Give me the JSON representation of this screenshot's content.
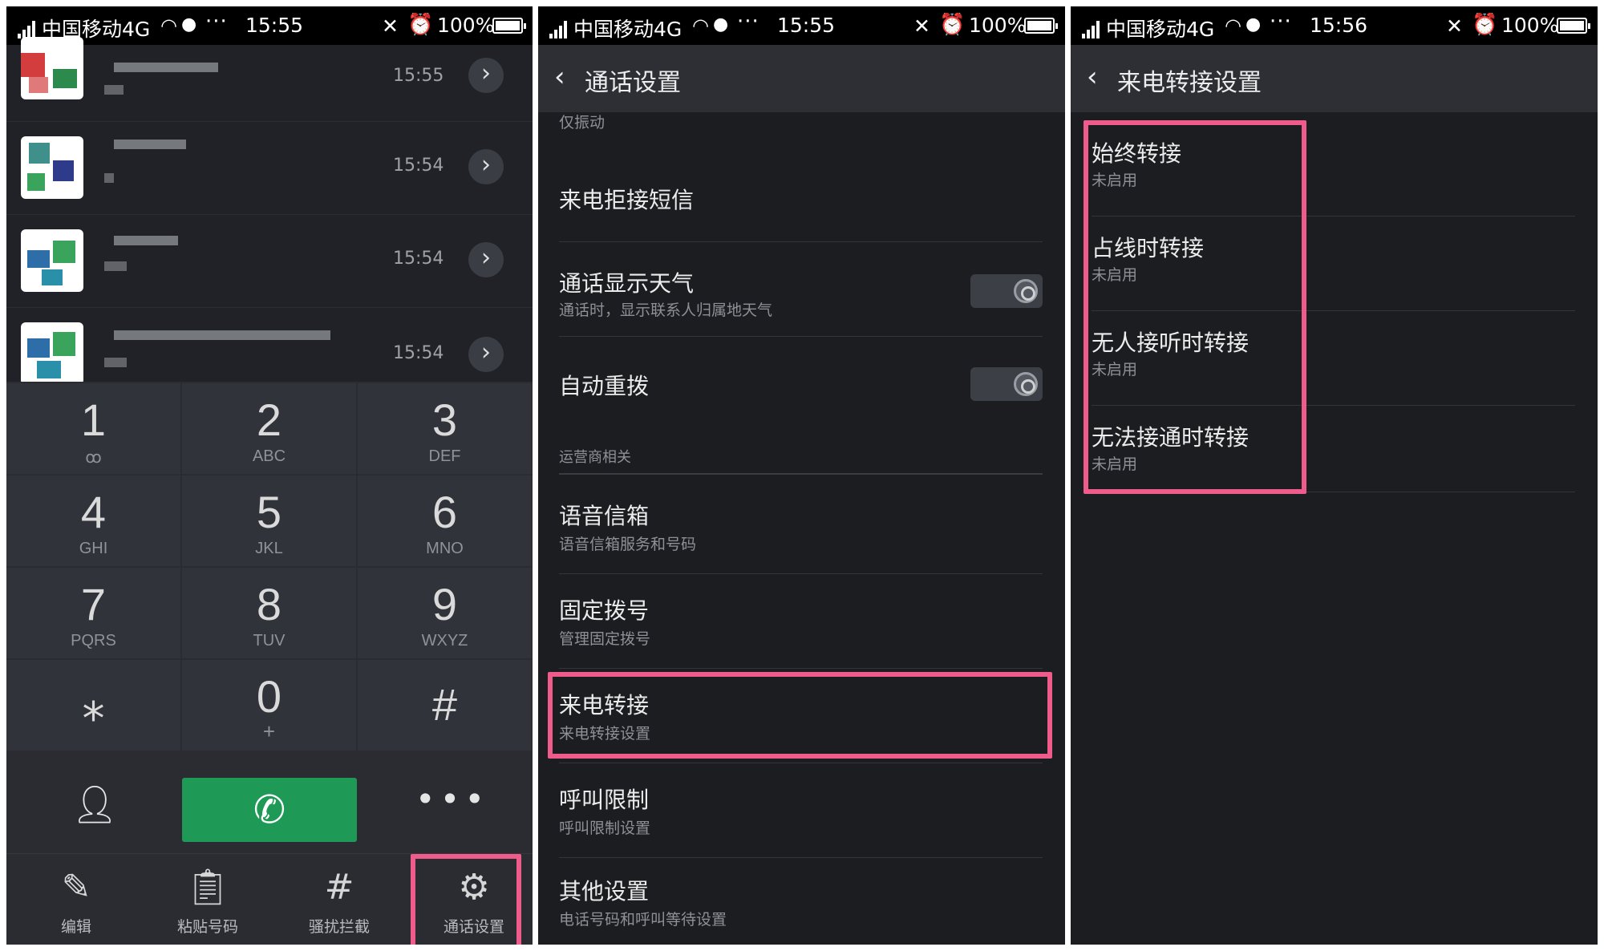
{
  "status_bars": [
    {
      "carrier": "中国移动4G",
      "time": "15:55",
      "battery": "100%",
      "battery_level": 1.0
    },
    {
      "carrier": "中国移动4G",
      "time": "15:55",
      "battery": "100%",
      "battery_level": 1.0
    },
    {
      "carrier": "中国移动4G",
      "time": "15:56",
      "battery": "100%",
      "battery_level": 1.0
    }
  ],
  "dialer": {
    "recent_calls": [
      {
        "time": "15:55"
      },
      {
        "time": "15:54"
      },
      {
        "time": "15:54"
      },
      {
        "time": "15:54"
      }
    ],
    "keys": [
      {
        "digit": "1",
        "letters": "ꝏ"
      },
      {
        "digit": "2",
        "letters": "ABC"
      },
      {
        "digit": "3",
        "letters": "DEF"
      },
      {
        "digit": "4",
        "letters": "GHI"
      },
      {
        "digit": "5",
        "letters": "JKL"
      },
      {
        "digit": "6",
        "letters": "MNO"
      },
      {
        "digit": "7",
        "letters": "PQRS"
      },
      {
        "digit": "8",
        "letters": "TUV"
      },
      {
        "digit": "9",
        "letters": "WXYZ"
      },
      {
        "digit": "⁎",
        "letters": ""
      },
      {
        "digit": "0",
        "letters": "+"
      },
      {
        "digit": "#",
        "letters": ""
      }
    ],
    "tabs": [
      {
        "label": "编辑",
        "icon": "edit-icon"
      },
      {
        "label": "粘贴号码",
        "icon": "clipboard-icon"
      },
      {
        "label": "骚扰拦截",
        "icon": "hash-icon"
      },
      {
        "label": "通话设置",
        "icon": "gear-icon"
      }
    ],
    "more_label": "•••"
  },
  "call_settings": {
    "title": "通话设置",
    "top_partial": "仅振动",
    "items": [
      {
        "main": "来电拒接短信",
        "sub": ""
      },
      {
        "main": "通话显示天气",
        "sub": "通话时，显示联系人归属地天气",
        "toggle": false
      },
      {
        "main": "自动重拨",
        "sub": "",
        "toggle": false
      }
    ],
    "section_label": "运营商相关",
    "carrier_items": [
      {
        "main": "语音信箱",
        "sub": "语音信箱服务和号码"
      },
      {
        "main": "固定拨号",
        "sub": "管理固定拨号"
      },
      {
        "main": "来电转接",
        "sub": "来电转接设置"
      },
      {
        "main": "呼叫限制",
        "sub": "呼叫限制设置"
      },
      {
        "main": "其他设置",
        "sub": "电话号码和呼叫等待设置"
      }
    ]
  },
  "forward_settings": {
    "title": "来电转接设置",
    "items": [
      {
        "main": "始终转接",
        "sub": "未启用"
      },
      {
        "main": "占线时转接",
        "sub": "未启用"
      },
      {
        "main": "无人接听时转接",
        "sub": "未启用"
      },
      {
        "main": "无法接通时转接",
        "sub": "未启用"
      }
    ]
  },
  "colors": {
    "highlight": "#ef5c8c",
    "dial_green": "#1e9a56",
    "panel_bg": "#1c1d21"
  }
}
